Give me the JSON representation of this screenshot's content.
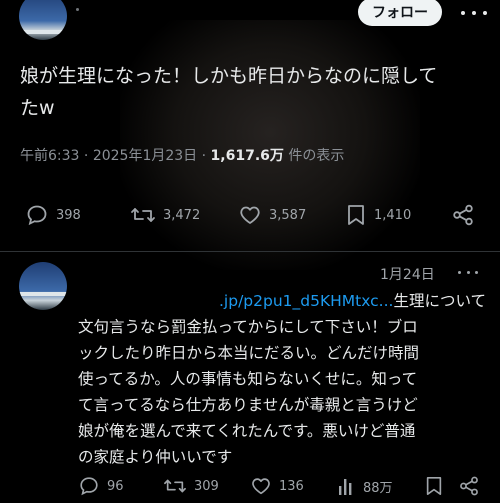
{
  "main_tweet": {
    "follow_label": "フォロー",
    "text_line1": "娘が生理になった！しかも昨日からなのに隠して",
    "text_line2": "たw",
    "time": "午前6:33",
    "date": "2025年1月23日",
    "views": "1,617.6万",
    "views_suffix": "件の表示",
    "replies": "398",
    "reposts": "3,472",
    "likes": "3,587",
    "bookmarks": "1,410"
  },
  "reply": {
    "date": "1月24日",
    "link": ".jp/p2pu1_d5KHMtxc...",
    "lines": [
      "生理について",
      "文句言うなら罰金払ってからにして下さい！ブロ",
      "ックしたり昨日から本当にだるい。どんだけ時間",
      "使ってるか。人の事情も知らないくせに。知って",
      "て言ってるなら仕方ありませんが毒親と言うけど",
      "娘が俺を選んで来てくれたんです。悪いけど普通",
      "の家庭より仲いいです"
    ],
    "replies": "96",
    "reposts": "309",
    "likes": "136",
    "views": "88万"
  },
  "icons": [
    "reply-icon",
    "repost-icon",
    "like-icon",
    "bookmark-icon",
    "share-icon",
    "views-icon",
    "more-icon"
  ],
  "colors": {
    "background": "#000000",
    "text": "#e7e9ea",
    "muted": "#71767b",
    "link": "#1d9bf0",
    "button": "#eff3f4"
  }
}
